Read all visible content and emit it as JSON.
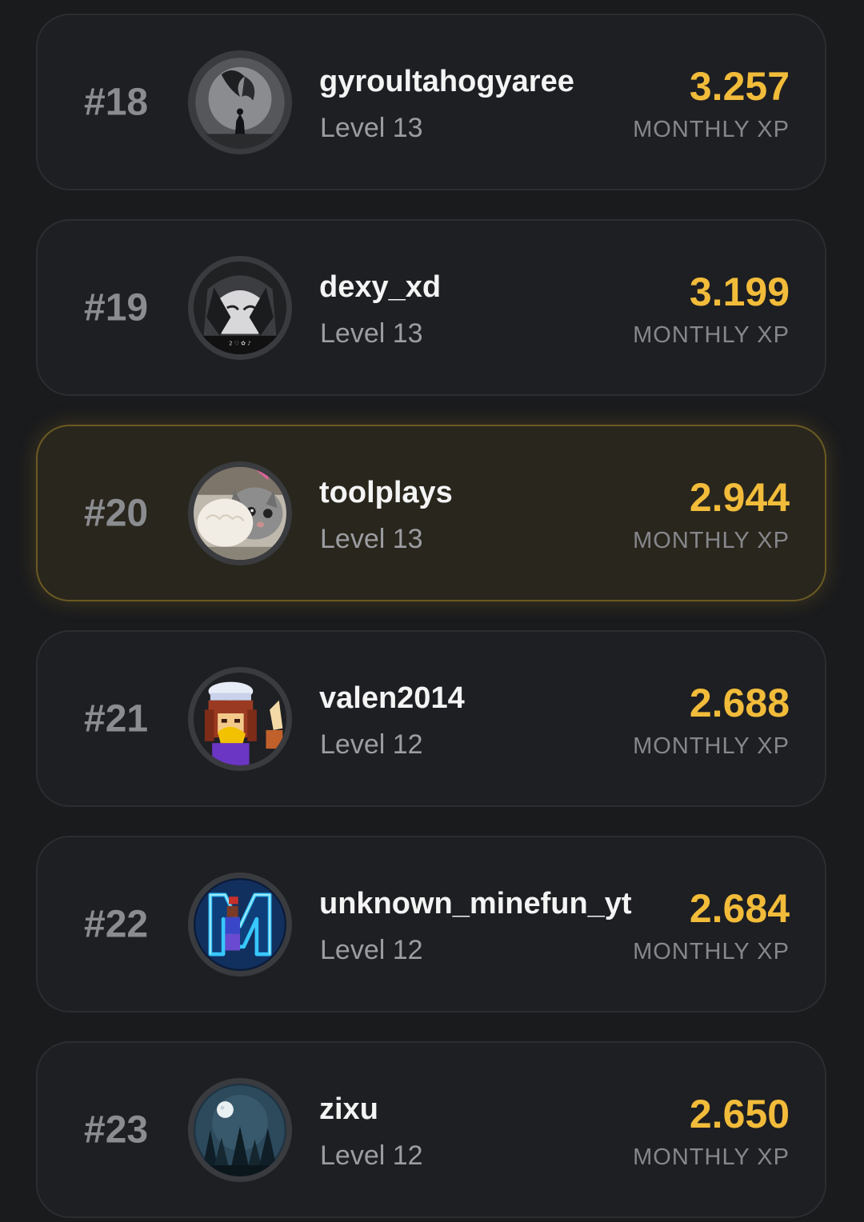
{
  "colors": {
    "background": "#1a1b1d",
    "card": "#1e1f22",
    "highlight_card": "#29261d",
    "highlight_border": "#6b5a22",
    "xp_accent": "#f2bc3a",
    "rank_text": "#8b8c90"
  },
  "leaderboard": {
    "entries": [
      {
        "rank": "#18",
        "username": "gyroultahogyaree",
        "level": "Level 13",
        "xp": "3.257",
        "xp_label": "MONTHLY XP",
        "avatar": "dragon-warrior-avatar",
        "highlighted": false
      },
      {
        "rank": "#19",
        "username": "dexy_xd",
        "level": "Level 13",
        "xp": "3.199",
        "xp_label": "MONTHLY XP",
        "avatar": "anime-girl-avatar",
        "highlighted": false
      },
      {
        "rank": "#20",
        "username": "toolplays",
        "level": "Level 13",
        "xp": "2.944",
        "xp_label": "MONTHLY XP",
        "avatar": "cat-paw-avatar",
        "highlighted": true
      },
      {
        "rank": "#21",
        "username": "valen2014",
        "level": "Level 12",
        "xp": "2.688",
        "xp_label": "MONTHLY XP",
        "avatar": "pixel-character-avatar",
        "highlighted": false
      },
      {
        "rank": "#22",
        "username": "unknown_minefun_yt",
        "level": "Level 12",
        "xp": "2.684",
        "xp_label": "MONTHLY XP",
        "avatar": "neon-letter-m-avatar",
        "highlighted": false
      },
      {
        "rank": "#23",
        "username": "zixu",
        "level": "Level 12",
        "xp": "2.650",
        "xp_label": "MONTHLY XP",
        "avatar": "moon-forest-avatar",
        "highlighted": false
      }
    ]
  }
}
